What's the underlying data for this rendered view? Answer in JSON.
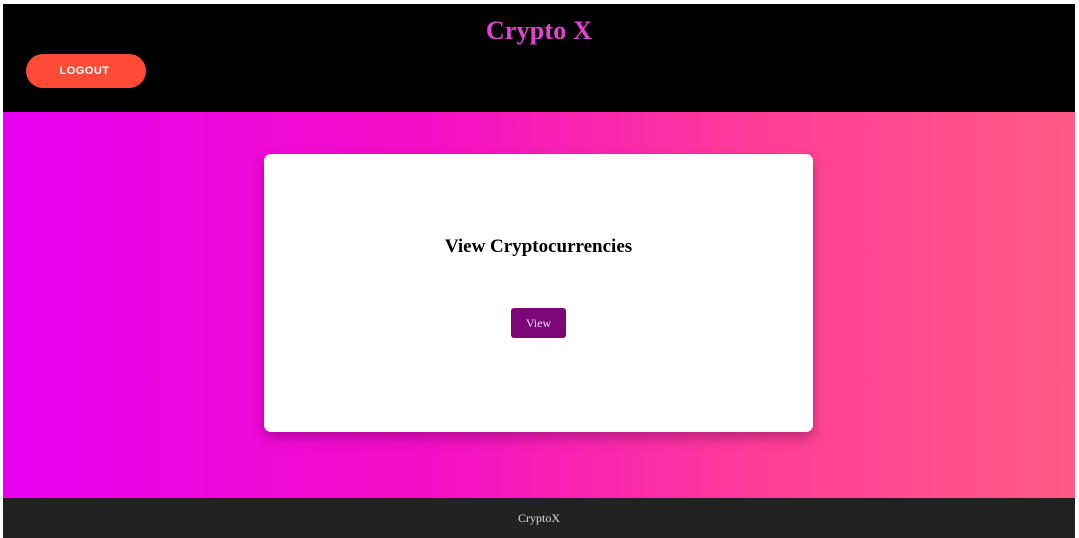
{
  "header": {
    "brand_title": "Crypto X",
    "logout_label": "LOGOUT"
  },
  "main": {
    "card_title": "View Cryptocurrencies",
    "view_button_label": "View"
  },
  "footer": {
    "text": "CryptoX"
  },
  "colors": {
    "header_bg": "#000000",
    "brand_color": "#e53fd6",
    "logout_bg": "#ff4b36",
    "gradient_start": "#e800f2",
    "gradient_end": "#ff5a86",
    "view_button_bg": "#7b0779",
    "footer_bg": "#222222"
  }
}
